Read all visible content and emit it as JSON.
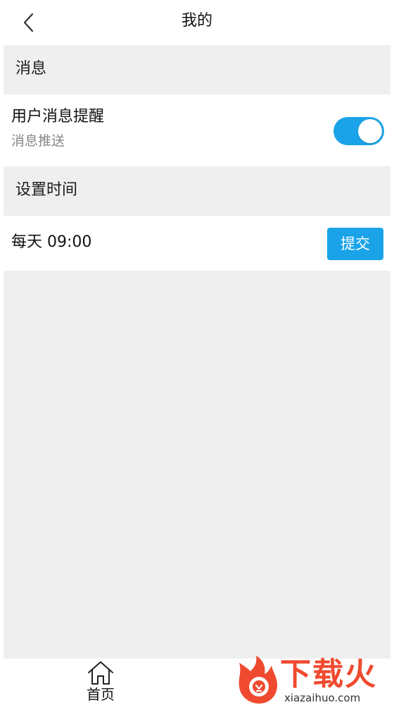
{
  "header": {
    "title": "我的",
    "back_icon": "chevron-left-icon"
  },
  "sections": {
    "messages": {
      "title": "消息"
    },
    "time": {
      "title": "设置时间"
    }
  },
  "notify": {
    "title": "用户消息提醒",
    "subtitle": "消息推送",
    "enabled": true,
    "toggle_color": "#1aa3e8"
  },
  "schedule": {
    "time_text": "每天 09:00",
    "submit_label": "提交",
    "button_color": "#1aa3e8"
  },
  "tabbar": {
    "home_label": "首页",
    "home_icon": "home-icon"
  },
  "watermark": {
    "text": "下载火",
    "url": "xiazaihuo.com",
    "color": "#ef4a2f"
  }
}
